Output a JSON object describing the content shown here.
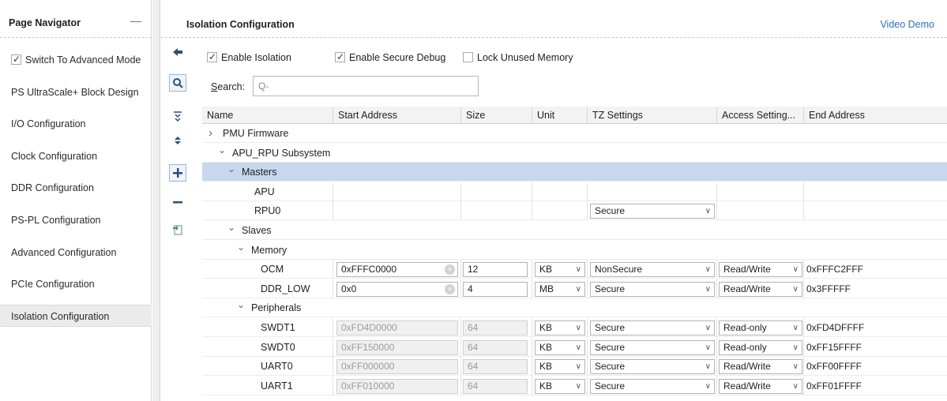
{
  "navigator": {
    "title": "Page Navigator",
    "minimize_icon": "minus-icon",
    "advanced_mode": {
      "label": "Switch To Advanced Mode",
      "checked": true
    },
    "items": [
      {
        "label": "PS UltraScale+ Block Design"
      },
      {
        "label": "I/O Configuration"
      },
      {
        "label": "Clock Configuration"
      },
      {
        "label": "DDR Configuration"
      },
      {
        "label": "PS-PL Configuration"
      },
      {
        "label": "Advanced Configuration"
      },
      {
        "label": "PCIe Configuration"
      },
      {
        "label": "Isolation Configuration",
        "selected": true
      }
    ]
  },
  "main": {
    "title": "Isolation Configuration",
    "video_demo": "Video Demo",
    "toolbar_icons": [
      "back-arrow-icon",
      "search-icon",
      "collapse-all-icon",
      "expand-all-icon",
      "add-icon",
      "remove-icon",
      "export-icon"
    ],
    "options": {
      "enable_isolation": {
        "label": "Enable Isolation",
        "checked": true
      },
      "enable_secure_debug": {
        "label": "Enable Secure Debug",
        "checked": true
      },
      "lock_unused_memory": {
        "label": "Lock Unused Memory",
        "checked": false
      }
    },
    "search": {
      "label_prefix": "S",
      "label_rest": "earch:",
      "placeholder": "Q-"
    },
    "columns": [
      "Name",
      "Start Address",
      "Size",
      "Unit",
      "TZ Settings",
      "Access Setting...",
      "End Address"
    ],
    "rows": [
      {
        "name": "PMU Firmware",
        "chevron": ">"
      },
      {
        "name": "APU_RPU Subsystem",
        "chevron": "v"
      },
      {
        "name": "Masters",
        "chevron": "v"
      },
      {
        "name": "APU"
      },
      {
        "name": "RPU0",
        "tz": "Secure"
      },
      {
        "name": "Slaves",
        "chevron": "v"
      },
      {
        "name": "Memory",
        "chevron": "v"
      },
      {
        "name": "OCM",
        "start": "0xFFFC0000",
        "size": "12",
        "unit": "KB",
        "tz": "NonSecure",
        "access": "Read/Write",
        "end": "0xFFFC2FFF"
      },
      {
        "name": "DDR_LOW",
        "start": "0x0",
        "size": "4",
        "unit": "MB",
        "tz": "Secure",
        "access": "Read/Write",
        "end": "0x3FFFFF"
      },
      {
        "name": "Peripherals",
        "chevron": "v"
      },
      {
        "name": "SWDT1",
        "start": "0xFD4D0000",
        "size": "64",
        "unit": "KB",
        "tz": "Secure",
        "access": "Read-only",
        "end": "0xFD4DFFFF"
      },
      {
        "name": "SWDT0",
        "start": "0xFF150000",
        "size": "64",
        "unit": "KB",
        "tz": "Secure",
        "access": "Read-only",
        "end": "0xFF15FFFF"
      },
      {
        "name": "UART0",
        "start": "0xFF000000",
        "size": "64",
        "unit": "KB",
        "tz": "Secure",
        "access": "Read/Write",
        "end": "0xFF00FFFF"
      },
      {
        "name": "UART1",
        "start": "0xFF010000",
        "size": "64",
        "unit": "KB",
        "tz": "Secure",
        "access": "Read/Write",
        "end": "0xFF01FFFF"
      }
    ]
  },
  "colors": {
    "selected_row": "#c7d8ec",
    "link": "#2f6fbf",
    "header_bg": "#f3f3f3"
  }
}
